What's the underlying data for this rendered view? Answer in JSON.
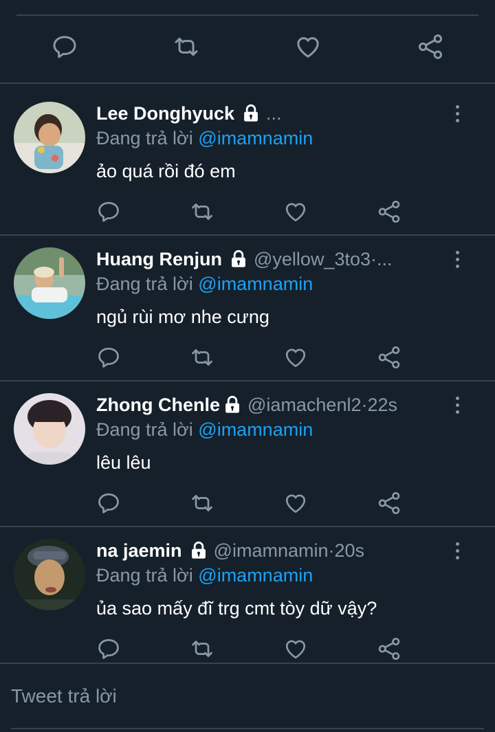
{
  "colors": {
    "background": "#15202b",
    "divider": "#38444d",
    "muted": "#8899a6",
    "accent": "#1da1f2",
    "text": "#ffffff"
  },
  "icons": {
    "reply": "reply-icon",
    "retweet": "retweet-icon",
    "like": "heart-icon",
    "share": "share-icon",
    "lock": "lock-icon",
    "more": "more-vertical-icon"
  },
  "replies": [
    {
      "name": "Lee Donghyuck",
      "handle": "",
      "dot": "",
      "time": "",
      "truncated": "...",
      "replying_label": "Đang trả lời",
      "replying_to": "@imamnamin",
      "text": "ảo quá rồi đó em"
    },
    {
      "name": "Huang Renjun",
      "handle": "@yellow_3to3",
      "dot": " · ",
      "time": "",
      "truncated": "...",
      "replying_label": "Đang trả lời",
      "replying_to": "@imamnamin",
      "text": "ngủ rùi mơ nhe cưng"
    },
    {
      "name": "Zhong Chenle",
      "handle": "@iamachenl2",
      "dot": " · ",
      "time": "22s",
      "truncated": "",
      "replying_label": "Đang trả lời",
      "replying_to": "@imamnamin",
      "text": "lêu lêu"
    },
    {
      "name": "na jaemin",
      "handle": "@imamnamin",
      "dot": " · ",
      "time": "20s",
      "truncated": "",
      "replying_label": "Đang trả lời",
      "replying_to": "@imamnamin",
      "text": "ủa sao mấy đĩ trg cmt tòy dữ vậy?"
    }
  ],
  "compose": {
    "placeholder": "Tweet trả lời"
  }
}
